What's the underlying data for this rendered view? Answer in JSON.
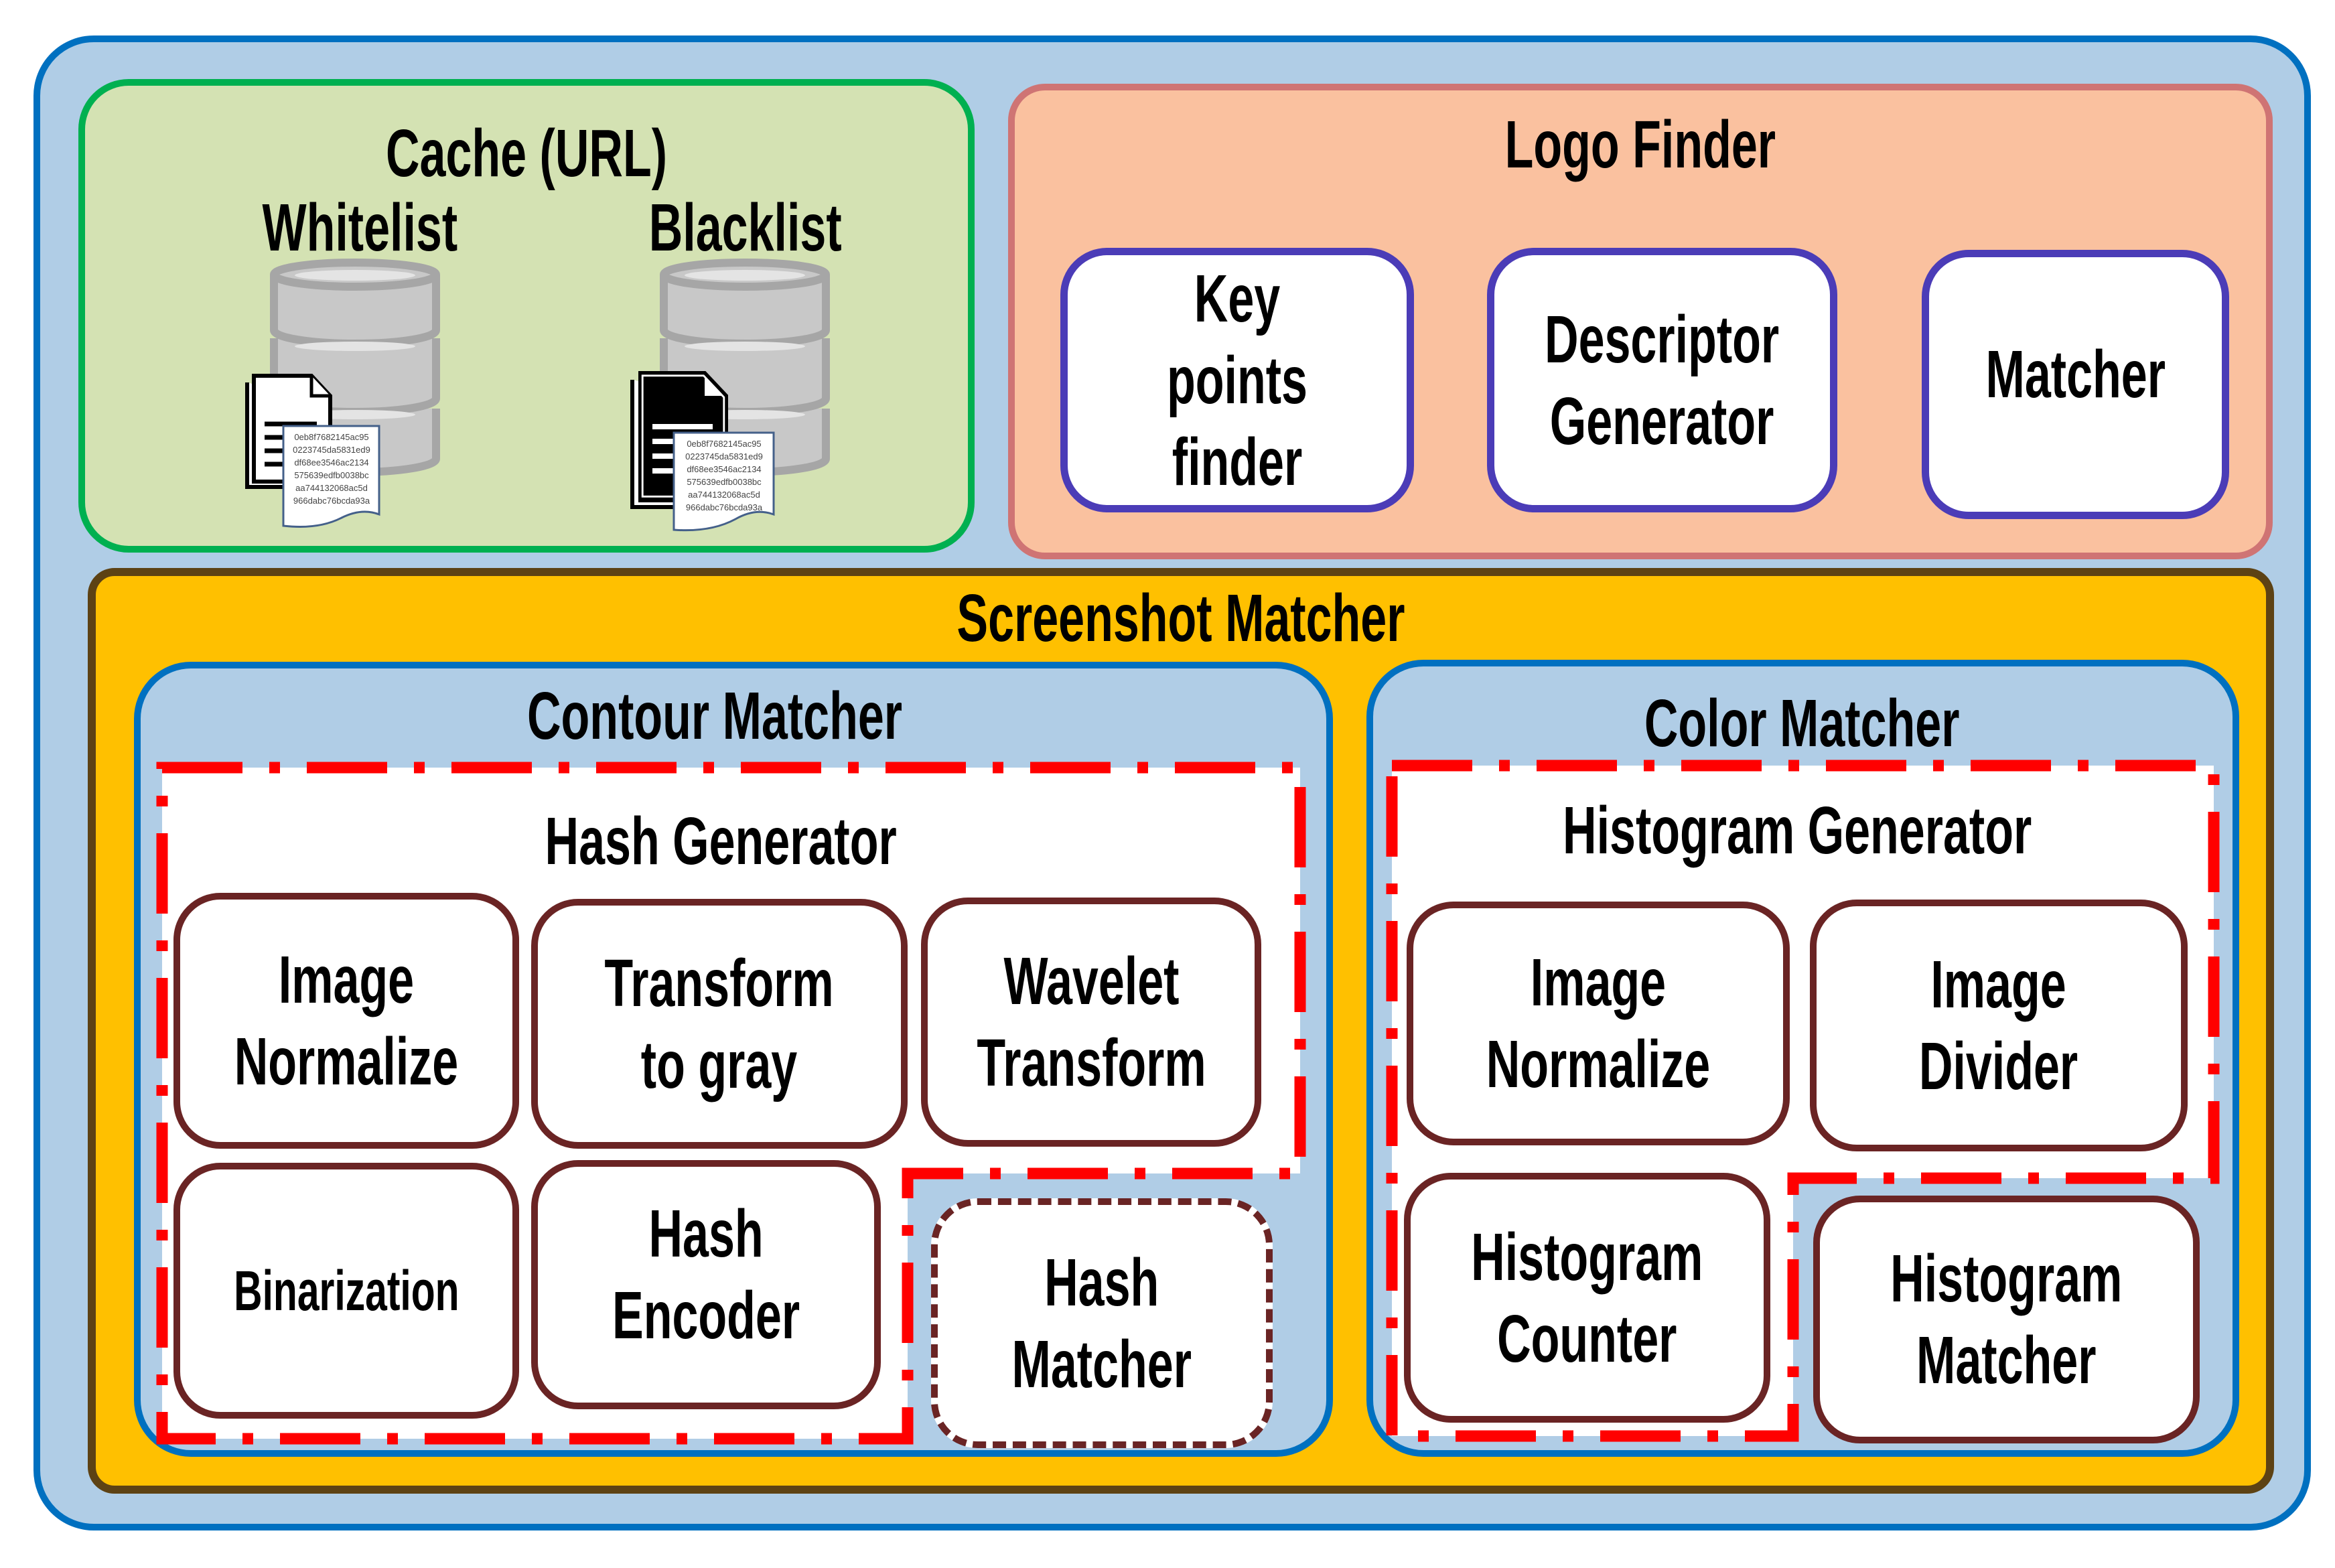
{
  "colors": {
    "outer_border": "#0070c0",
    "outer_fill": "#b0cde6",
    "cache_border": "#00b050",
    "cache_fill": "#d4e2b3",
    "logo_border": "#cf7474",
    "logo_fill": "#fac19f",
    "screenshot_border": "#5d4214",
    "screenshot_fill": "#ffc000",
    "component_border_purple": "#4b3cb7",
    "component_border_brown": "#6a2424",
    "generator_outline": "#ff0000"
  },
  "cache": {
    "title": "Cache (URL)",
    "whitelist": {
      "label": "Whitelist",
      "icon": "database-icon",
      "doc_icon": "white-document-icon",
      "hashes": [
        "0eb8f7682145ac95",
        "0223745da5831ed9",
        "df68ee3546ac2134",
        "575639edfb0038bc",
        "aa744132068ac5d",
        "966dabc76bcda93a"
      ]
    },
    "blacklist": {
      "label": "Blacklist",
      "icon": "database-icon",
      "doc_icon": "black-document-icon",
      "hashes": [
        "0eb8f7682145ac95",
        "0223745da5831ed9",
        "df68ee3546ac2134",
        "575639edfb0038bc",
        "aa744132068ac5d",
        "966dabc76bcda93a"
      ]
    }
  },
  "logo_finder": {
    "title": "Logo Finder",
    "components": [
      "Key points\nfinder",
      "Descriptor\nGenerator",
      "Matcher"
    ]
  },
  "screenshot_matcher": {
    "title": "Screenshot Matcher",
    "contour_matcher": {
      "title": "Contour Matcher",
      "generator_title": "Hash Generator",
      "components": [
        "Image\nNormalize",
        "Transform\nto gray",
        "Wavelet\nTransform",
        "Binarization",
        "Hash\nEncoder"
      ],
      "matcher": "Hash\nMatcher"
    },
    "color_matcher": {
      "title": "Color Matcher",
      "generator_title": "Histogram Generator",
      "components": [
        "Image\nNormalize",
        "Image\nDivider",
        "Histogram\nCounter"
      ],
      "matcher": "Histogram\nMatcher"
    }
  }
}
